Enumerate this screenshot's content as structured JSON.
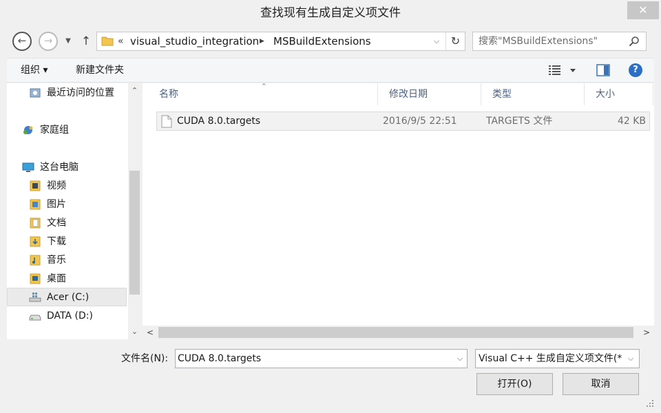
{
  "window": {
    "title": "查找现有生成自定义项文件",
    "close_glyph": "✕"
  },
  "nav_buttons": {
    "back_glyph": "←",
    "forward_glyph": "→",
    "dropdown_glyph": "▼",
    "up_glyph": "↑"
  },
  "address": {
    "overflow_glyph": "«",
    "crumbs": [
      "visual_studio_integration",
      "MSBuildExtensions"
    ],
    "separator_glyph": "▶",
    "dropdown_glyph": "⌵",
    "refresh_glyph": "↻"
  },
  "search": {
    "placeholder": "搜索\"MSBuildExtensions\""
  },
  "toolbar": {
    "organize_label": "组织 ▾",
    "new_folder_label": "新建文件夹",
    "help_glyph": "?"
  },
  "nav_pane": {
    "items": [
      {
        "label": "最近访问的位置",
        "icon": "recent-places-icon"
      },
      {
        "label": "家庭组",
        "icon": "homegroup-icon"
      },
      {
        "label": "这台电脑",
        "icon": "this-pc-icon"
      },
      {
        "label": "视频",
        "icon": "videos-folder-icon"
      },
      {
        "label": "图片",
        "icon": "pictures-folder-icon"
      },
      {
        "label": "文档",
        "icon": "documents-folder-icon"
      },
      {
        "label": "下载",
        "icon": "downloads-folder-icon"
      },
      {
        "label": "音乐",
        "icon": "music-folder-icon"
      },
      {
        "label": "桌面",
        "icon": "desktop-folder-icon"
      },
      {
        "label": "Acer (C:)",
        "icon": "windows-drive-icon",
        "selected": true
      },
      {
        "label": "DATA (D:)",
        "icon": "drive-icon"
      }
    ],
    "scroll_up_glyph": "⌃",
    "scroll_down_glyph": "⌄"
  },
  "file_list": {
    "columns": [
      "名称",
      "修改日期",
      "类型",
      "大小"
    ],
    "sort_glyph": "^",
    "rows": [
      {
        "name": "CUDA 8.0.targets",
        "modified": "2016/9/5 22:51",
        "type": "TARGETS 文件",
        "size": "42 KB"
      }
    ],
    "scroll_left_glyph": "<",
    "scroll_right_glyph": ">"
  },
  "footer": {
    "filename_label": "文件名(N):",
    "filename_value": "CUDA 8.0.targets",
    "filetype_value": "Visual C++ 生成自定义项文件(*",
    "dropdown_glyph": "⌵",
    "open_label": "打开(O)",
    "cancel_label": "取消"
  },
  "colors": {
    "accent": "#2c6fc4",
    "folder": "#f1c54e",
    "header_text": "#4d6182"
  }
}
